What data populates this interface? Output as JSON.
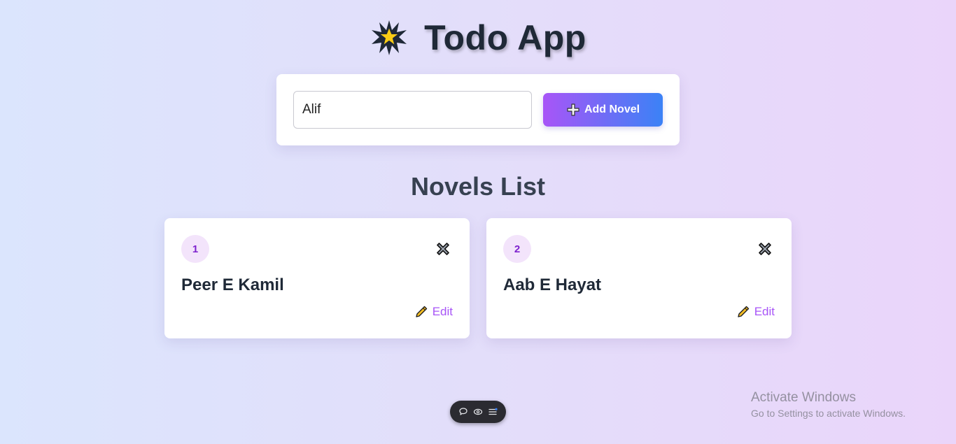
{
  "header": {
    "title": "Todo App",
    "icon": "star-icon"
  },
  "form": {
    "input_value": "Alif",
    "add_button_label": "Add Novel",
    "add_button_icon": "plus-icon"
  },
  "list": {
    "title": "Novels List",
    "items": [
      {
        "number": "1",
        "name": "Peer E Kamil",
        "edit_label": "Edit"
      },
      {
        "number": "2",
        "name": "Aab E Hayat",
        "edit_label": "Edit"
      }
    ]
  },
  "toolbar": {
    "icons": [
      "chat-bubble-icon",
      "eye-icon",
      "menu-icon"
    ]
  },
  "watermark": {
    "title": "Activate Windows",
    "subtitle": "Go to Settings to activate Windows."
  },
  "colors": {
    "accent_purple": "#a855f7",
    "accent_blue": "#3b82f6",
    "badge_bg": "#f3e4fb",
    "badge_text": "#7e22ce",
    "heading": "#1f2937"
  }
}
